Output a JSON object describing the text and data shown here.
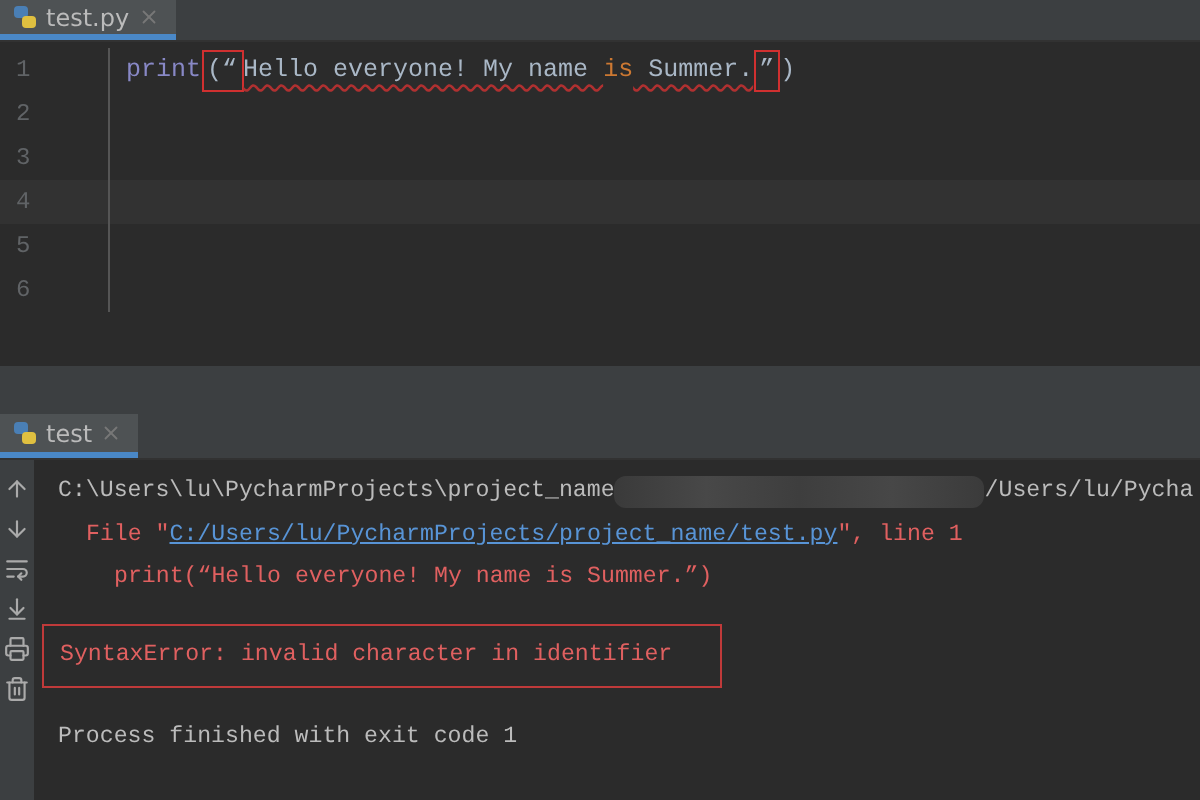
{
  "editor_tabs": [
    {
      "label": "test.py",
      "selected": true
    }
  ],
  "code_lines": [
    {
      "number": "1",
      "tokens": [
        {
          "kind": "builtin",
          "text": "print"
        },
        {
          "kind": "plain",
          "text": "(“",
          "marked": true
        },
        {
          "kind": "string",
          "text": "Hello everyone! My name "
        },
        {
          "kind": "keyword",
          "text": "is"
        },
        {
          "kind": "string",
          "text": " Summer."
        },
        {
          "kind": "plain",
          "text": "”",
          "marked": true
        },
        {
          "kind": "plain",
          "text": ")"
        }
      ]
    },
    {
      "number": "2"
    },
    {
      "number": "3"
    },
    {
      "number": "4",
      "current": true
    },
    {
      "number": "5"
    },
    {
      "number": "6"
    }
  ],
  "run_tabs": [
    {
      "label": "test",
      "selected": true
    }
  ],
  "console_lines": [
    {
      "kind": "command",
      "text": "C:\\Users\\lu\\PycharmProjects\\project_name",
      "after_redaction": "/Users/lu/Pycha"
    },
    {
      "kind": "file_ref",
      "prefix": "File \"",
      "link": "C:/Users/lu/PycharmProjects/project_name/test.py",
      "suffix": "\", line 1"
    },
    {
      "kind": "source",
      "text": "print(“Hello everyone! My name is Summer.”)"
    },
    {
      "kind": "error",
      "text": "SyntaxError: invalid character in identifier",
      "marked": true
    },
    {
      "kind": "exit",
      "text": "Process finished with exit code 1"
    }
  ]
}
